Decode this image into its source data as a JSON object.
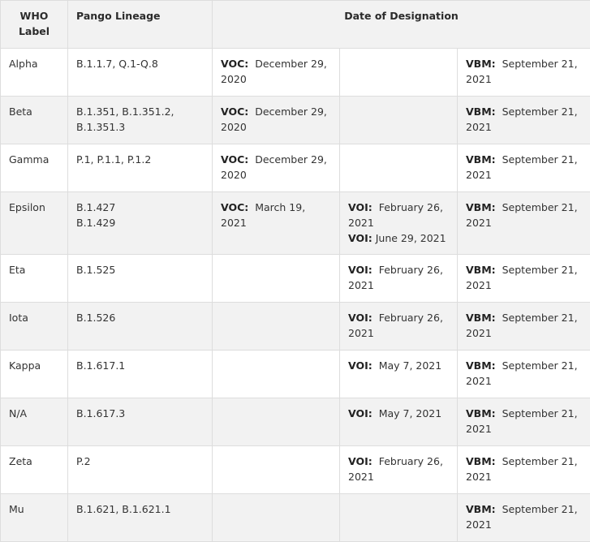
{
  "headers": {
    "who_label": "WHO Label",
    "pango_lineage": "Pango Lineage",
    "date_of_designation": "Date of Designation"
  },
  "rows": [
    {
      "who": "Alpha",
      "pango": "B.1.1.7, Q.1-Q.8",
      "voc_tag": "VOC:",
      "voc": "December 29, 2020",
      "voi_tag": "",
      "voi": "",
      "voi2_tag": "",
      "voi2": "",
      "vbm_tag": "VBM:",
      "vbm": "September 21, 2021"
    },
    {
      "who": "Beta",
      "pango": "B.1.351, B.1.351.2, B.1.351.3",
      "voc_tag": "VOC:",
      "voc": "December 29, 2020",
      "voi_tag": "",
      "voi": "",
      "voi2_tag": "",
      "voi2": "",
      "vbm_tag": "VBM:",
      "vbm": "September 21, 2021"
    },
    {
      "who": "Gamma",
      "pango": "P.1, P.1.1, P.1.2",
      "voc_tag": "VOC:",
      "voc": "December 29, 2020",
      "voi_tag": "",
      "voi": "",
      "voi2_tag": "",
      "voi2": "",
      "vbm_tag": "VBM:",
      "vbm": "September 21, 2021"
    },
    {
      "who": "Epsilon",
      "pango": "B.1.427",
      "pango2": "B.1.429",
      "voc_tag": "VOC:",
      "voc": "March 19, 2021",
      "voi_tag": "VOI:",
      "voi": "February 26, 2021",
      "voi2_tag": "VOI:",
      "voi2": "June 29, 2021",
      "vbm_tag": "VBM:",
      "vbm": "September 21, 2021"
    },
    {
      "who": "Eta",
      "pango": "B.1.525",
      "voc_tag": "",
      "voc": "",
      "voi_tag": "VOI:",
      "voi": "February 26, 2021",
      "voi2_tag": "",
      "voi2": "",
      "vbm_tag": "VBM:",
      "vbm": "September 21, 2021"
    },
    {
      "who": "Iota",
      "pango": "B.1.526",
      "voc_tag": "",
      "voc": "",
      "voi_tag": "VOI:",
      "voi": "February 26, 2021",
      "voi2_tag": "",
      "voi2": "",
      "vbm_tag": "VBM:",
      "vbm": "September 21, 2021"
    },
    {
      "who": "Kappa",
      "pango": "B.1.617.1",
      "voc_tag": "",
      "voc": "",
      "voi_tag": "VOI:",
      "voi": "May 7, 2021",
      "voi2_tag": "",
      "voi2": "",
      "vbm_tag": "VBM:",
      "vbm": "September 21, 2021"
    },
    {
      "who": "N/A",
      "pango": "B.1.617.3",
      "voc_tag": "",
      "voc": "",
      "voi_tag": "VOI:",
      "voi": "May 7, 2021",
      "voi2_tag": "",
      "voi2": "",
      "vbm_tag": "VBM:",
      "vbm": "September 21, 2021"
    },
    {
      "who": "Zeta",
      "pango": "P.2",
      "voc_tag": "",
      "voc": "",
      "voi_tag": "VOI:",
      "voi": "February 26, 2021",
      "voi2_tag": "",
      "voi2": "",
      "vbm_tag": "VBM:",
      "vbm": "September 21, 2021"
    },
    {
      "who": "Mu",
      "pango": "B.1.621, B.1.621.1",
      "voc_tag": "",
      "voc": "",
      "voi_tag": "",
      "voi": "",
      "voi2_tag": "",
      "voi2": "",
      "vbm_tag": "VBM:",
      "vbm": "September 21, 2021"
    }
  ]
}
